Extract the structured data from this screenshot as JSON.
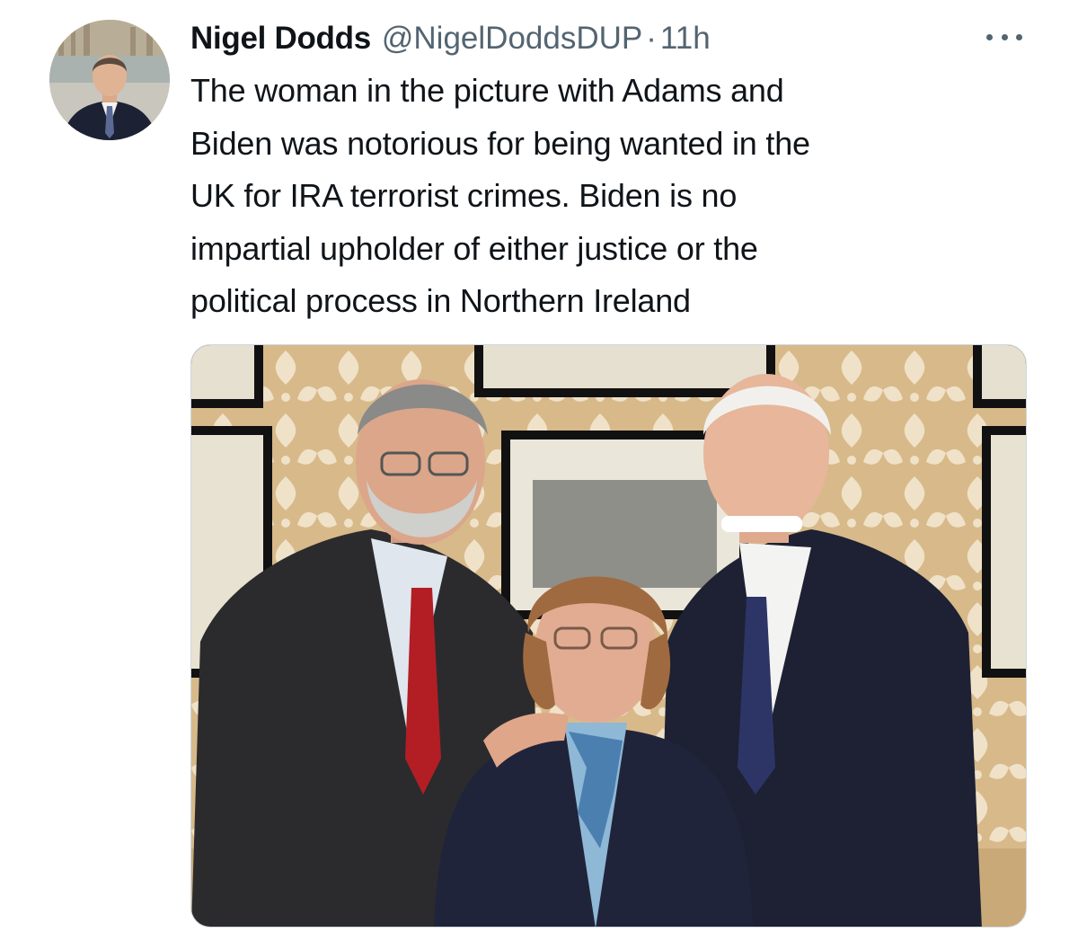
{
  "tweet": {
    "author_name": "Nigel Dodds",
    "author_handle": "@NigelDoddsDUP",
    "separator": "·",
    "timestamp": "11h",
    "text_lines": [
      "The woman in the picture with Adams and",
      "Biden was notorious for being wanted in the",
      "UK for IRA terrorist crimes. Biden is no",
      "impartial upholder of either justice or the",
      "political process in Northern Ireland"
    ],
    "more_icon": "more-horizontal-icon",
    "colors": {
      "text": "#0f1419",
      "secondary": "#536471",
      "border": "#cfd9de"
    }
  }
}
